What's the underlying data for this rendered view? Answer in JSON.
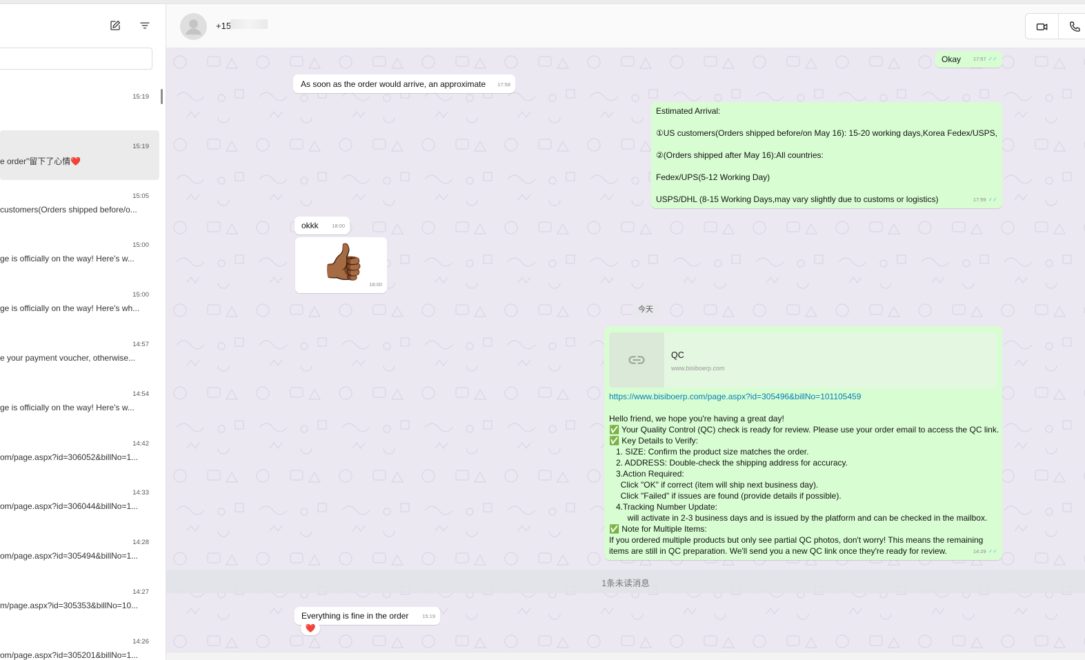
{
  "sidebar": {
    "chats": [
      {
        "time": "15:19",
        "preview": ""
      },
      {
        "time": "15:19",
        "preview": "e order\"留下了心情❤️"
      },
      {
        "time": "15:05",
        "preview": "customers(Orders shipped before/o..."
      },
      {
        "time": "15:00",
        "preview": "ge is officially on the way!  Here's w..."
      },
      {
        "time": "15:00",
        "preview": "ge is officially on the way!  Here's wh..."
      },
      {
        "time": "14:57",
        "preview": "e your payment voucher, otherwise..."
      },
      {
        "time": "14:54",
        "preview": "ge is officially on the way!  Here's w..."
      },
      {
        "time": "14:42",
        "preview": "om/page.aspx?id=306052&billNo=1..."
      },
      {
        "time": "14:33",
        "preview": "om/page.aspx?id=306044&billNo=1..."
      },
      {
        "time": "14:28",
        "preview": "om/page.aspx?id=305494&billNo=1..."
      },
      {
        "time": "14:27",
        "preview": "m/page.aspx?id=305353&billNo=10..."
      },
      {
        "time": "14:26",
        "preview": "om/page.aspx?id=305201&billNo=1..."
      }
    ]
  },
  "header": {
    "contact_name": "+15",
    "icons": [
      "video-camera-icon",
      "phone-icon"
    ]
  },
  "messages": {
    "okay": {
      "text": "Okay",
      "time": "17:57"
    },
    "approx": {
      "text": "As soon as the order would arrive, an approximate",
      "time": "17:58"
    },
    "arrival": {
      "lines": [
        "Estimated Arrival:",
        "",
        "①US customers(Orders shipped before/on May 16): 15-20 working days,Korea Fedex/USPS,",
        "",
        "②(Orders shipped after May 16):All countries:",
        "",
        "Fedex/UPS(5-12 Working Day)",
        "",
        "USPS/DHL (8-15 Working Days,may vary slightly due to customs or logistics)"
      ],
      "time": "17:59"
    },
    "okkk": {
      "text": "okkk",
      "time": "18:00"
    },
    "thumbs": {
      "emoji": "👍🏾",
      "time": "18:00"
    },
    "day_divider": "今天",
    "qc": {
      "card_title": "QC",
      "card_domain": "www.bisiboerp.com",
      "url": "https://www.bisiboerp.com/page.aspx?id=305496&billNo=101105459",
      "lines": [
        "Hello friend, we hope you're having a great day!",
        "✅ Your Quality Control (QC) check is ready for review. Please use your order email to access the QC link.",
        "✅ Key Details to Verify:",
        "   1. SIZE: Confirm the product size matches the order.",
        "   2. ADDRESS: Double-check the shipping address for accuracy.",
        "   3.Action Required:",
        "     Click \"OK\" if correct (item will ship next business day).",
        "     Click \"Failed\" if issues are found (provide details if possible).",
        "   4.Tracking Number Update:",
        "        will activate in 2-3 business days and is issued by the platform and can be checked in the mailbox.",
        "✅ Note for Multiple Items:",
        "If you ordered multiple products but only see partial QC photos, don't worry! This means the remaining",
        "items are still in QC preparation. We'll send you a new QC link once they're ready for review."
      ],
      "time": "14:29"
    },
    "unread_divider": "1条未读消息",
    "fine": {
      "text": "Everything is fine in the order",
      "time": "15:19",
      "reaction": "❤️"
    }
  }
}
